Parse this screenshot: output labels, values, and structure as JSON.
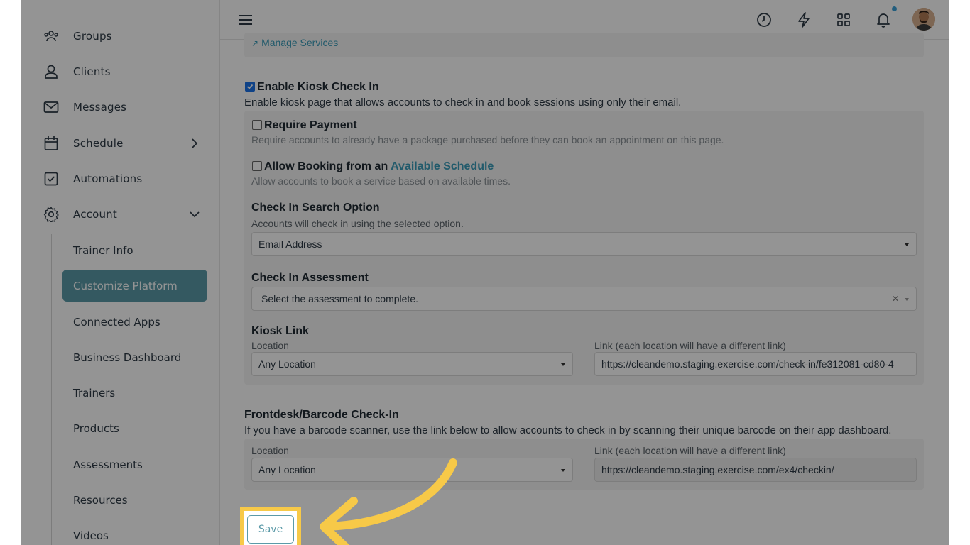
{
  "sidebar": {
    "items": [
      {
        "label": "Groups",
        "icon": "groups-icon"
      },
      {
        "label": "Clients",
        "icon": "user-icon"
      },
      {
        "label": "Messages",
        "icon": "envelope-icon"
      },
      {
        "label": "Schedule",
        "icon": "calendar-icon"
      },
      {
        "label": "Automations",
        "icon": "checkbox-square-icon"
      },
      {
        "label": "Account",
        "icon": "gear-icon"
      }
    ],
    "subitems": [
      {
        "label": "Trainer Info"
      },
      {
        "label": "Customize Platform"
      },
      {
        "label": "Connected Apps"
      },
      {
        "label": "Business Dashboard"
      },
      {
        "label": "Trainers"
      },
      {
        "label": "Products"
      },
      {
        "label": "Assessments"
      },
      {
        "label": "Resources"
      },
      {
        "label": "Videos"
      }
    ]
  },
  "topbar": {
    "icons": [
      "hamburger-menu-icon",
      "clock-icon",
      "lightning-icon",
      "grid-icon",
      "bell-icon",
      "avatar"
    ]
  },
  "content": {
    "manage_services_link": "Manage Services",
    "kiosk": {
      "label": "Enable Kiosk Check In",
      "checked": true,
      "description": "Enable kiosk page that allows accounts to check in and book sessions using only their email.",
      "require_payment": {
        "label": "Require Payment",
        "checked": false,
        "description": "Require accounts to already have a package purchased before they can book an appointment on this page."
      },
      "allow_booking": {
        "label_prefix": "Allow Booking from an",
        "label_link": "Available Schedule",
        "checked": false,
        "description": "Allow accounts to book a service based on available times."
      },
      "search_option": {
        "title": "Check In Search Option",
        "description": "Accounts will check in using the selected option.",
        "value": "Email Address"
      },
      "assessment": {
        "title": "Check In Assessment",
        "placeholder": "Select the assessment to complete."
      },
      "kiosk_link": {
        "title": "Kiosk Link",
        "location_label": "Location",
        "location_value": "Any Location",
        "link_label": "Link (each location will have a different link)",
        "link_value": "https://cleandemo.staging.exercise.com/check-in/fe312081-cd80-4"
      }
    },
    "frontdesk": {
      "title": "Frontdesk/Barcode Check-In",
      "description": "If you have a barcode scanner, use the link below to allow accounts to check in by scanning their unique barcode on their app dashboard.",
      "location_label": "Location",
      "location_value": "Any Location",
      "link_label": "Link (each location will have a different link)",
      "link_value": "https://cleandemo.staging.exercise.com/ex4/checkin/"
    },
    "save_label": "Save"
  },
  "colors": {
    "accent": "#5b9aa8",
    "highlight": "#f7c948",
    "link": "#3a9bb8"
  }
}
